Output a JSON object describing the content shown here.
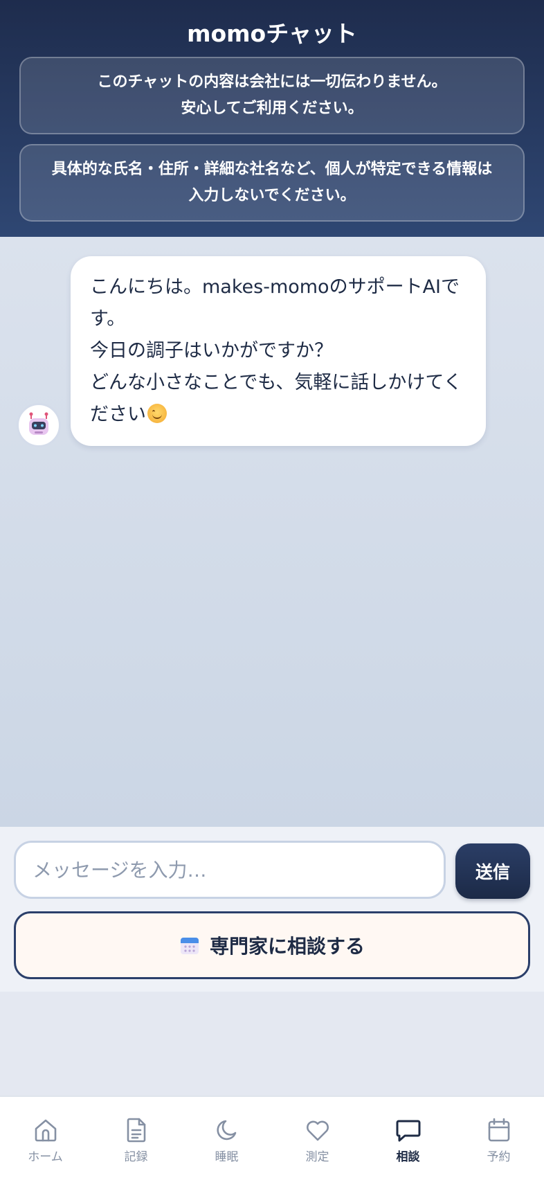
{
  "header": {
    "title": "momoチャット",
    "notices": [
      {
        "lines": [
          "このチャットの内容は会社には一切伝わりません。",
          "安心してご利用ください。"
        ]
      },
      {
        "lines": [
          "具体的な氏名・住所・詳細な社名など、個人が特定できる情報は",
          "入力しないでください。"
        ]
      }
    ]
  },
  "chat": {
    "messages": [
      {
        "sender": "bot",
        "avatar_icon": "robot-icon",
        "lines": [
          "こんにちは。makes-momoのサポートAIです。",
          "今日の調子はいかがですか？",
          "どんな小さなことでも、気軽に話しかけてください"
        ],
        "trailing_icon": "smiling-face-icon"
      }
    ]
  },
  "composer": {
    "placeholder": "メッセージを入力…",
    "value": "",
    "send_label": "送信",
    "expert_label": "専門家に相談する",
    "expert_icon": "calendar-icon"
  },
  "bottom_nav": {
    "items": [
      {
        "label": "ホーム",
        "icon": "home-icon",
        "active": false
      },
      {
        "label": "記録",
        "icon": "document-icon",
        "active": false
      },
      {
        "label": "睡眠",
        "icon": "moon-icon",
        "active": false
      },
      {
        "label": "測定",
        "icon": "heart-icon",
        "active": false
      },
      {
        "label": "相談",
        "icon": "chat-bubble-icon",
        "active": true
      },
      {
        "label": "予約",
        "icon": "calendar-icon",
        "active": false
      }
    ]
  },
  "colors": {
    "header_top": "#1e2c4d",
    "header_bottom": "#2f4773",
    "accent": "#1e2b45",
    "inactive": "#8590a3"
  }
}
